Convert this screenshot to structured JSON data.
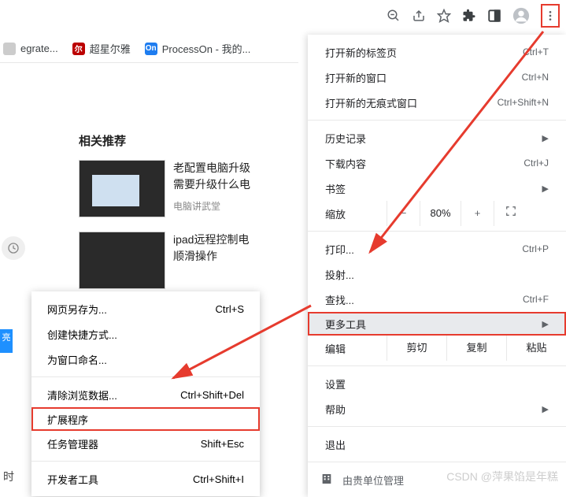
{
  "toolbar": {
    "zoom_out_icon": "zoom-out",
    "share_icon": "share",
    "star_icon": "star",
    "ext_icon": "puzzle",
    "reading_icon": "reading-list",
    "profile_icon": "profile",
    "more_icon": "more-vert"
  },
  "bookmarks": [
    {
      "label": "egrate...",
      "favicon_bg": "#ccc",
      "favicon_text": ""
    },
    {
      "label": "超星尔雅",
      "favicon_bg": "#b00",
      "favicon_text": "尔"
    },
    {
      "label": "ProcessOn - 我的...",
      "favicon_bg": "#1e7df0",
      "favicon_text": "On"
    }
  ],
  "content": {
    "heading": "相关推荐",
    "cards": [
      {
        "title": "老配置电脑升级",
        "sub": "需要升级什么电",
        "source": "电脑讲武堂"
      },
      {
        "title": "ipad远程控制电",
        "sub": "顺滑操作",
        "source": ""
      }
    ]
  },
  "blue_strip": "亮",
  "bottom_char": "时",
  "main_menu": {
    "new_tab": {
      "label": "打开新的标签页",
      "shortcut": "Ctrl+T"
    },
    "new_window": {
      "label": "打开新的窗口",
      "shortcut": "Ctrl+N"
    },
    "incognito": {
      "label": "打开新的无痕式窗口",
      "shortcut": "Ctrl+Shift+N"
    },
    "history": {
      "label": "历史记录"
    },
    "downloads": {
      "label": "下载内容",
      "shortcut": "Ctrl+J"
    },
    "bookmarks": {
      "label": "书签"
    },
    "zoom": {
      "label": "缩放",
      "minus": "−",
      "value": "80%",
      "plus": "+"
    },
    "print": {
      "label": "打印...",
      "shortcut": "Ctrl+P"
    },
    "cast": {
      "label": "投射..."
    },
    "find": {
      "label": "查找...",
      "shortcut": "Ctrl+F"
    },
    "more_tools": {
      "label": "更多工具"
    },
    "edit": {
      "label": "编辑",
      "cut": "剪切",
      "copy": "复制",
      "paste": "粘贴"
    },
    "settings": {
      "label": "设置"
    },
    "help": {
      "label": "帮助"
    },
    "exit": {
      "label": "退出"
    },
    "managed": {
      "label": "由贵单位管理"
    }
  },
  "sub_menu": {
    "save_as": {
      "label": "网页另存为...",
      "shortcut": "Ctrl+S"
    },
    "shortcut": {
      "label": "创建快捷方式..."
    },
    "name_window": {
      "label": "为窗口命名..."
    },
    "clear_data": {
      "label": "清除浏览数据...",
      "shortcut": "Ctrl+Shift+Del"
    },
    "extensions": {
      "label": "扩展程序"
    },
    "task_manager": {
      "label": "任务管理器",
      "shortcut": "Shift+Esc"
    },
    "dev_tools": {
      "label": "开发者工具",
      "shortcut": "Ctrl+Shift+I"
    }
  },
  "watermark": "CSDN @萍果馅是年糕"
}
